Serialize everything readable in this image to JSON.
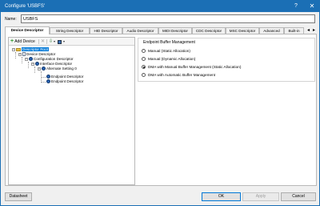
{
  "window": {
    "title": "Configure 'USBFS'",
    "help": "?",
    "close": "✕"
  },
  "name": {
    "label": "Name:",
    "value": "USBFS"
  },
  "tabs": [
    {
      "label": "Device Descriptor",
      "active": true
    },
    {
      "label": "String Descriptor"
    },
    {
      "label": "HID Descriptor"
    },
    {
      "label": "Audio Descriptor"
    },
    {
      "label": "MIDI Descriptor"
    },
    {
      "label": "CDC Descriptor"
    },
    {
      "label": "MSC Descriptor"
    },
    {
      "label": "Advanced"
    },
    {
      "label": "Built-in"
    }
  ],
  "tab_scroll": {
    "left": "◂",
    "right": "▸"
  },
  "toolbar": {
    "add_label": "Add Device"
  },
  "tree": {
    "root": "Descriptor Root",
    "device": "Device Descriptor",
    "configuration": "Configuration Descriptor",
    "interface": "Interface Descriptor",
    "alternate": "Alternate Setting 0",
    "endpoint1": "Endpoint Descriptor",
    "endpoint2": "Endpoint Descriptor"
  },
  "buffer": {
    "title": "Endpoint Buffer Management",
    "options": [
      {
        "label": "Manual (Static Allocation)",
        "checked": false
      },
      {
        "label": "Manual (Dynamic Allocation)",
        "checked": false
      },
      {
        "label": "DMA with Manual Buffer Management (Static Allocation)",
        "checked": true
      },
      {
        "label": "DMA with Automatic Buffer Management",
        "checked": false
      }
    ]
  },
  "buttons": {
    "datasheet": "Datasheet",
    "ok": "OK",
    "apply": "Apply",
    "cancel": "Cancel"
  },
  "colors": {
    "titlebar": "#1b6fb5",
    "selection": "#0078d7"
  }
}
